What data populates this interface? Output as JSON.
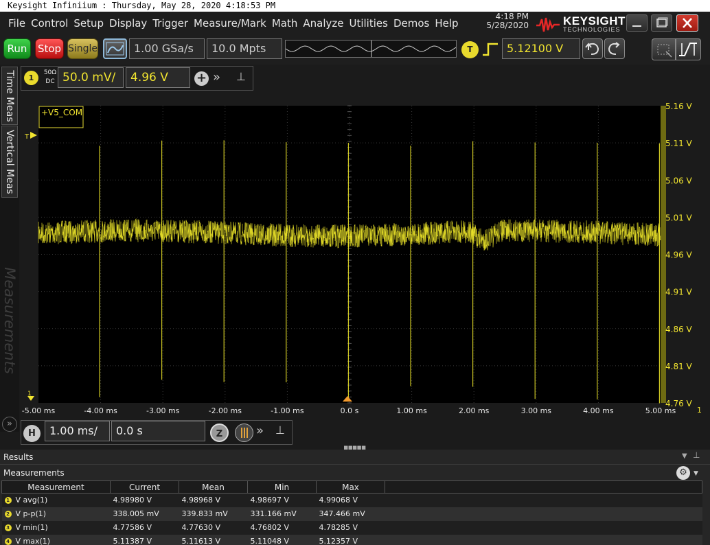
{
  "title_bar": "Keysight Infiniium : Thursday, May 28, 2020 4:18:53 PM",
  "menu": [
    "File",
    "Control",
    "Setup",
    "Display",
    "Trigger",
    "Measure/Mark",
    "Math",
    "Analyze",
    "Utilities",
    "Demos",
    "Help"
  ],
  "clock": {
    "time": "4:18 PM",
    "date": "5/28/2020"
  },
  "logo": {
    "brand": "KEYSIGHT",
    "sub": "TECHNOLOGIES"
  },
  "toolbar": {
    "run_label": "Run",
    "stop_label": "Stop",
    "single_label": "Single",
    "sample_rate": "1.00 GSa/s",
    "memory_depth": "10.0 Mpts",
    "trigger_badge": "T",
    "trigger_level": "5.12100 V"
  },
  "tabs": {
    "time_meas": "Time Meas",
    "vertical_meas": "Vertical Meas",
    "measurements": "Measurements",
    "expand": "»"
  },
  "channel": {
    "badge": "1",
    "impedance": "50Ω",
    "coupling": "DC",
    "scale": "50.0 mV/",
    "offset": "4.96 V",
    "more": "»",
    "pin": "⊥",
    "add": "+"
  },
  "waveform": {
    "label": "+V5_COM",
    "trigger_marker": "T",
    "ground_marker": "1",
    "right_edge_marker": "1",
    "y_ticks": [
      "5.16 V",
      "5.11 V",
      "5.06 V",
      "5.01 V",
      "4.96 V",
      "4.91 V",
      "4.86 V",
      "4.81 V",
      "4.76 V"
    ],
    "x_ticks": [
      "-5.00 ms",
      "-4.00 ms",
      "-3.00 ms",
      "-2.00 ms",
      "-1.00 ms",
      "0.0 s",
      "1.00 ms",
      "2.00 ms",
      "3.00 ms",
      "4.00 ms",
      "5.00 ms"
    ],
    "trace_color": "#f2ea2a"
  },
  "horizontal": {
    "badge": "H",
    "scale": "1.00 ms/",
    "position": "0.0 s",
    "zoom_label": "Z",
    "more": "»",
    "pin": "⊥"
  },
  "results": {
    "header": "Results",
    "measurements_title": "Measurements",
    "columns": [
      "Measurement",
      "Current",
      "Mean",
      "Min",
      "Max"
    ],
    "rows": [
      {
        "n": "1",
        "name": "V avg(1)",
        "current": "4.98980 V",
        "mean": "4.98968 V",
        "min": "4.98697 V",
        "max": "4.99068 V"
      },
      {
        "n": "2",
        "name": "V p-p(1)",
        "current": "338.005 mV",
        "mean": "339.833 mV",
        "min": "331.166 mV",
        "max": "347.466 mV"
      },
      {
        "n": "3",
        "name": "V min(1)",
        "current": "4.77586 V",
        "mean": "4.77630 V",
        "min": "4.76802 V",
        "max": "4.78285 V"
      },
      {
        "n": "4",
        "name": "V max(1)",
        "current": "5.11387 V",
        "mean": "5.11613 V",
        "min": "5.11048 V",
        "max": "5.12357 V"
      }
    ]
  }
}
